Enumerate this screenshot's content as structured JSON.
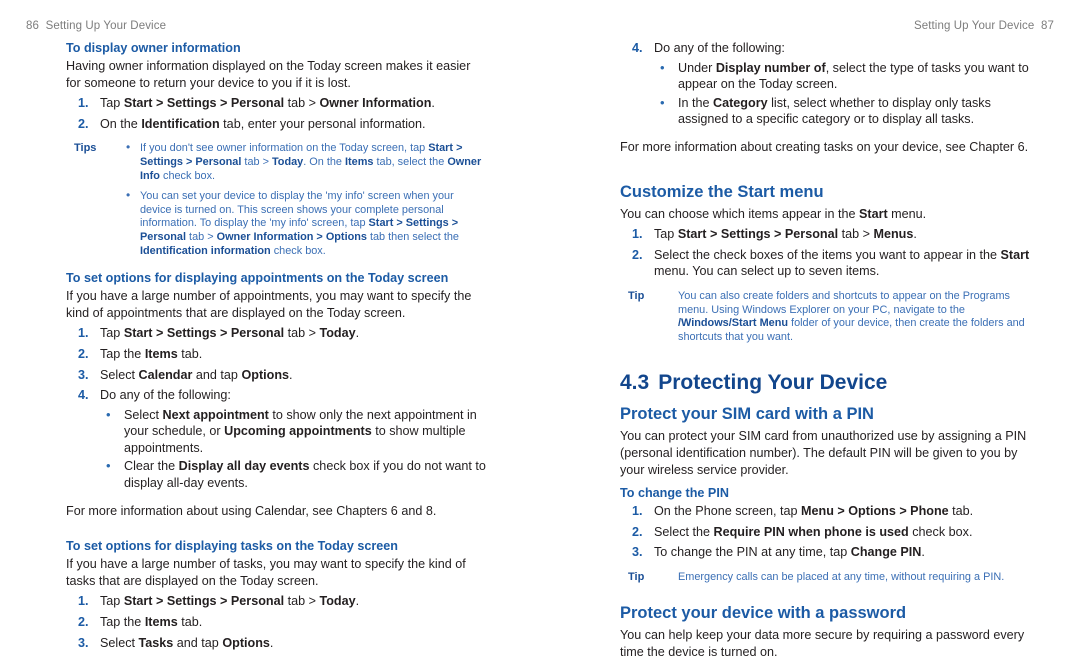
{
  "running_head": {
    "left_folio": "86",
    "left_title": "Setting Up Your Device",
    "right_title": "Setting Up Your Device",
    "right_folio": "87"
  },
  "colors": {
    "heading_blue": "#1c5ba5",
    "section_blue": "#12468c",
    "tip_blue": "#3b6fb5",
    "body_black": "#231f20",
    "runhead_gray": "#7d7d7d"
  },
  "left_column": {
    "owner_info": {
      "heading": "To display owner information",
      "intro": "Having owner information displayed on the Today screen makes it easier for someone to return your device to you if it is lost.",
      "steps": [
        {
          "num": "1.",
          "html": "Tap <b>Start &gt; Settings &gt; Personal</b> tab &gt; <b>Owner Information</b>."
        },
        {
          "num": "2.",
          "html": "On the <b>Identification</b> tab, enter your personal information."
        }
      ],
      "tips_label": "Tips",
      "tips": [
        "If you don't see owner information on the Today screen, tap <b>Start &gt; Settings &gt; Personal</b> tab &gt; <b>Today</b>. On the <b>Items</b> tab, select the <b>Owner Info</b> check box.",
        "You can set your device to display the 'my info' screen when your device is turned on. This screen shows your complete personal information. To display the 'my info' screen, tap <b>Start &gt; Settings &gt; Personal</b> tab &gt; <b>Owner Information &gt; Options</b> tab then select the <b>Identification information</b> check box."
      ]
    },
    "appointments": {
      "heading": "To set options for displaying appointments on the Today screen",
      "intro": "If you have a large number of appointments, you may want to specify the kind of appointments that are displayed on the Today screen.",
      "steps": [
        {
          "num": "1.",
          "html": "Tap <b>Start &gt; Settings &gt; Personal</b> tab &gt; <b>Today</b>."
        },
        {
          "num": "2.",
          "html": "Tap the <b>Items</b> tab."
        },
        {
          "num": "3.",
          "html": "Select <b>Calendar</b> and tap <b>Options</b>."
        },
        {
          "num": "4.",
          "html": "Do any of the following:"
        }
      ],
      "substeps": [
        "Select <b>Next appointment</b> to show only the next appointment in your schedule, or <b>Upcoming appointments</b> to show multiple appointments.",
        "Clear the <b>Display all day events</b> check box if you do not want to display all-day events."
      ],
      "footnote": "For more information about using Calendar, see Chapters 6 and 8."
    },
    "tasks": {
      "heading": "To set options for displaying tasks on the Today screen",
      "intro": "If you have a large number of tasks, you may want to specify the kind of tasks that are displayed on the Today screen.",
      "steps": [
        {
          "num": "1.",
          "html": "Tap <b>Start &gt; Settings &gt; Personal</b> tab &gt; <b>Today</b>."
        },
        {
          "num": "2.",
          "html": "Tap the <b>Items</b> tab."
        },
        {
          "num": "3.",
          "html": "Select <b>Tasks</b> and tap <b>Options</b>."
        }
      ]
    }
  },
  "right_column": {
    "tasks_cont": {
      "steps": [
        {
          "num": "4.",
          "html": "Do any of the following:"
        }
      ],
      "substeps": [
        "Under <b>Display number of</b>, select the type of tasks you want to appear on the Today screen.",
        "In the <b>Category</b> list, select whether to display only tasks assigned to a specific category or to display all tasks."
      ],
      "footnote": "For more information about creating tasks on your device, see Chapter 6."
    },
    "start_menu": {
      "heading": "Customize the Start menu",
      "intro": "You can choose which items appear in the <b>Start</b> menu.",
      "steps": [
        {
          "num": "1.",
          "html": "Tap <b>Start &gt; Settings &gt; Personal</b> tab &gt; <b>Menus</b>."
        },
        {
          "num": "2.",
          "html": "Select the check boxes of the items you want to appear in the <b>Start</b> menu. You can select up to seven items."
        }
      ],
      "tip_label": "Tip",
      "tip": "You can also create folders and shortcuts to appear on the Programs menu. Using Windows Explorer on your PC, navigate to the <b>/Windows/Start Menu</b> folder of your device, then create the folders and shortcuts that you want."
    },
    "section": {
      "number": "4.3",
      "title": "Protecting Your Device"
    },
    "sim_pin": {
      "heading": "Protect your SIM card with a PIN",
      "intro": "You can protect your SIM card from unauthorized use by assigning a PIN (personal identification number). The default PIN will be given to you by your wireless service provider.",
      "sub_heading": "To change the PIN",
      "steps": [
        {
          "num": "1.",
          "html": "On the Phone screen, tap <b>Menu &gt; Options &gt; Phone</b> tab."
        },
        {
          "num": "2.",
          "html": "Select the <b>Require PIN when phone is used</b> check box."
        },
        {
          "num": "3.",
          "html": "To change the PIN at any time, tap <b>Change PIN</b>."
        }
      ],
      "tip_label": "Tip",
      "tip": "Emergency calls can be placed at any time, without requiring a PIN."
    },
    "password": {
      "heading": "Protect your device with a password",
      "intro": "You can help keep your data more secure by requiring a password every time the device is turned on."
    }
  }
}
